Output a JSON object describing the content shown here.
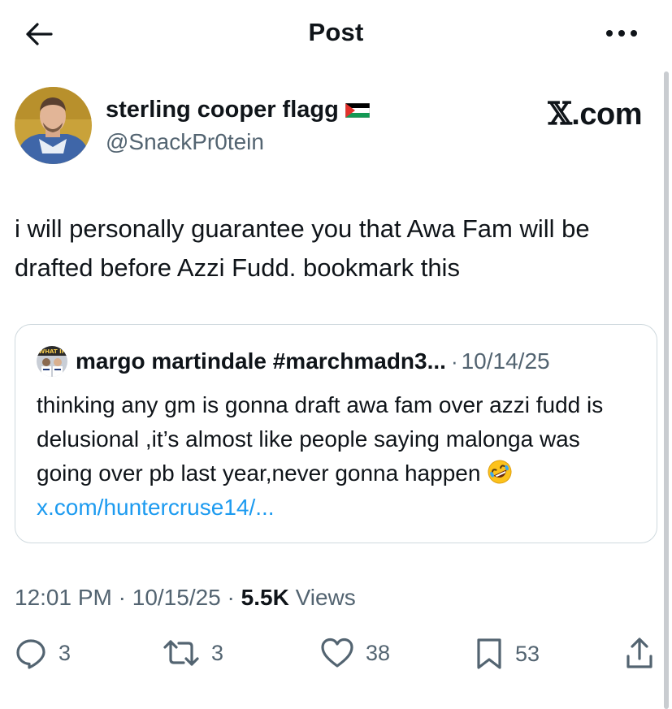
{
  "header": {
    "title": "Post"
  },
  "author": {
    "display_name": "sterling cooper flagg",
    "handle": "@SnackPr0tein"
  },
  "watermark": {
    "prefix": "𝕏",
    "suffix": ".com"
  },
  "tweet": {
    "text": "i will personally guarantee you that Awa Fam will be drafted before Azzi Fudd. bookmark this"
  },
  "quote": {
    "display_name": "margo martindale #marchmadn3...",
    "separator": "·",
    "date": "10/14/25",
    "text": "thinking any gm is gonna draft awa fam over azzi fudd is delusional ,it’s almost like people saying malonga was going over pb last year,never gonna happen",
    "link": "x.com/huntercruse14/...",
    "avatar_text": "WHAT IF"
  },
  "meta": {
    "time": "12:01 PM",
    "sep1": " · ",
    "date": "10/15/25",
    "sep2": " · ",
    "views_count": "5.5K",
    "views_label": " Views"
  },
  "actions": {
    "replies": "3",
    "reposts": "3",
    "likes": "38",
    "bookmarks": "53"
  },
  "colors": {
    "text": "#0f1419",
    "secondary": "#536471",
    "link": "#1d9bf0",
    "border": "#cfd9de"
  }
}
